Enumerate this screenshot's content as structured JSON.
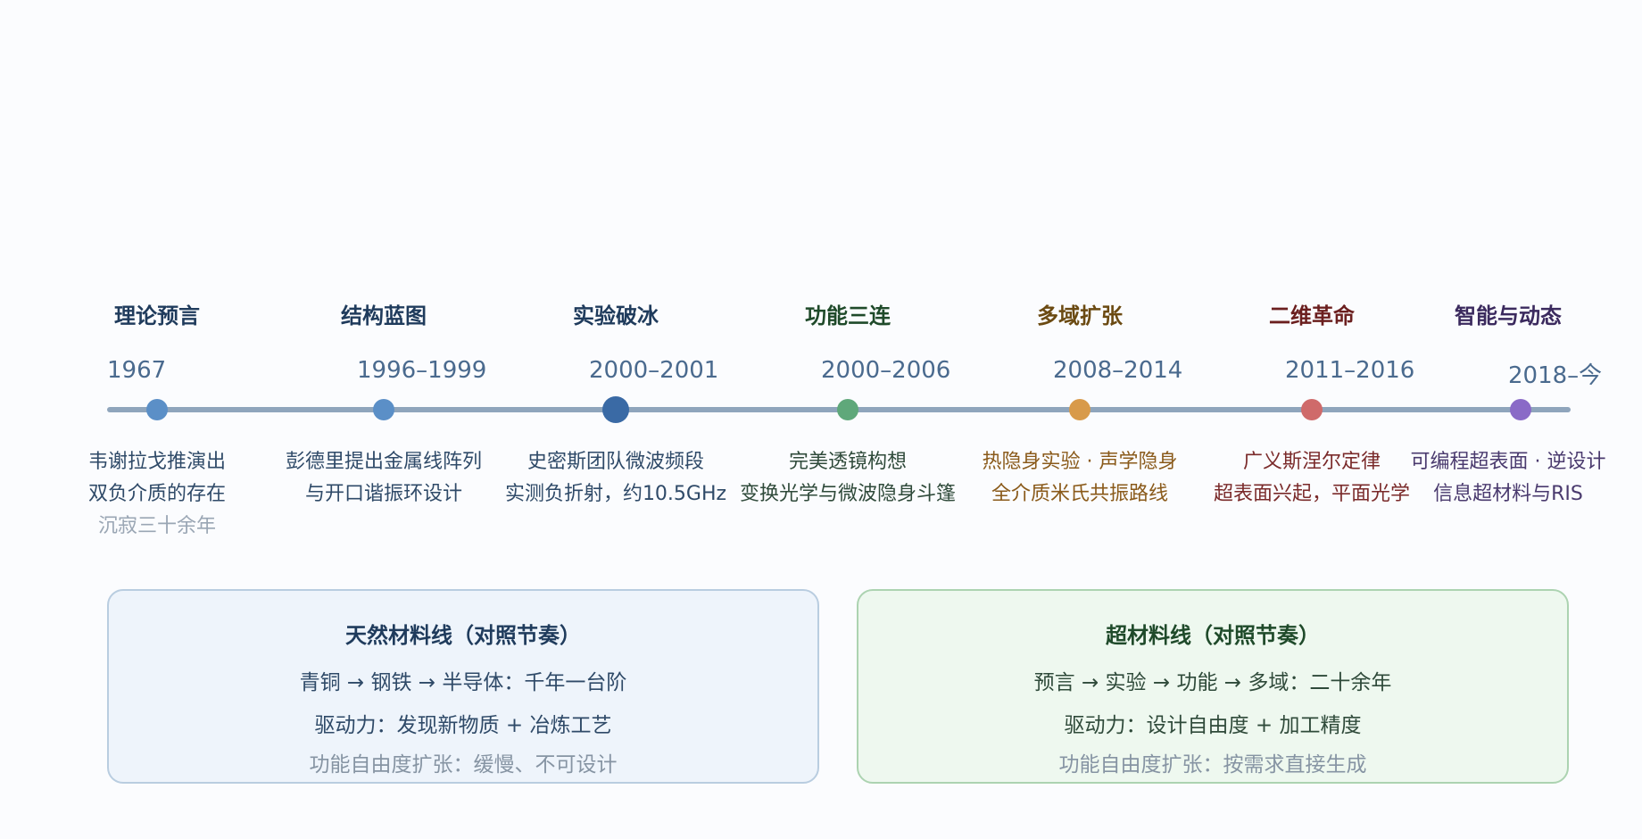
{
  "phases": [
    {
      "title": "理论预言",
      "date": "1967",
      "color": "#1f3b5c",
      "dot_color": "#5b8fc7",
      "desc": [
        "韦谢拉戈推演出",
        "双负介质的存在",
        "沉寂三十余年"
      ],
      "desc_color": "#2f4a68",
      "big": false
    },
    {
      "title": "结构蓝图",
      "date": "1996–1999",
      "color": "#1f3b5c",
      "dot_color": "#5b8fc7",
      "desc": [
        "彭德里提出金属线阵列",
        "与开口谐振环设计"
      ],
      "desc_color": "#2f4a68",
      "big": false
    },
    {
      "title": "实验破冰",
      "date": "2000–2001",
      "color": "#1f3b5c",
      "dot_color": "#3a6aa5",
      "desc": [
        "史密斯团队微波频段",
        "实测负折射，约10.5GHz"
      ],
      "desc_color": "#2f4a68",
      "big": true
    },
    {
      "title": "功能三连",
      "date": "2000–2006",
      "color": "#1f4a2a",
      "dot_color": "#5fa87a",
      "desc": [
        "完美透镜构想",
        "变换光学与微波隐身斗篷"
      ],
      "desc_color": "#2f4a3a",
      "big": false
    },
    {
      "title": "多域扩张",
      "date": "2008–2014",
      "color": "#6b4a12",
      "dot_color": "#d89a4a",
      "desc": [
        "热隐身实验 · 声学隐身",
        "全介质米氏共振路线"
      ],
      "desc_color": "#8a5a1a",
      "big": false
    },
    {
      "title": "二维革命",
      "date": "2011–2016",
      "color": "#6b1f1f",
      "dot_color": "#cf6a6a",
      "desc": [
        "广义斯涅尔定律",
        "超表面兴起，平面光学"
      ],
      "desc_color": "#7a2a2a",
      "big": false
    },
    {
      "title": "智能与动态",
      "date": "2018–今",
      "color": "#3b2a5e",
      "dot_color": "#8a6ac7",
      "desc": [
        "可编程超表面 · 逆设计",
        "信息超材料与RIS"
      ],
      "desc_color": "#4a3a6e",
      "big": false
    }
  ],
  "panels": {
    "natural": {
      "title": "天然材料线（对照节奏）",
      "line1": "青铜 → 钢铁 → 半导体：千年一台阶",
      "line2": "驱动力：发现新物质 + 冶炼工艺",
      "line3": "功能自由度扩张：缓慢、不可设计"
    },
    "meta": {
      "title": "超材料线（对照节奏）",
      "line1": "预言 → 实验 → 功能 → 多域：二十余年",
      "line2": "驱动力：设计自由度 + 加工精度",
      "line3": "功能自由度扩张：按需求直接生成"
    }
  }
}
